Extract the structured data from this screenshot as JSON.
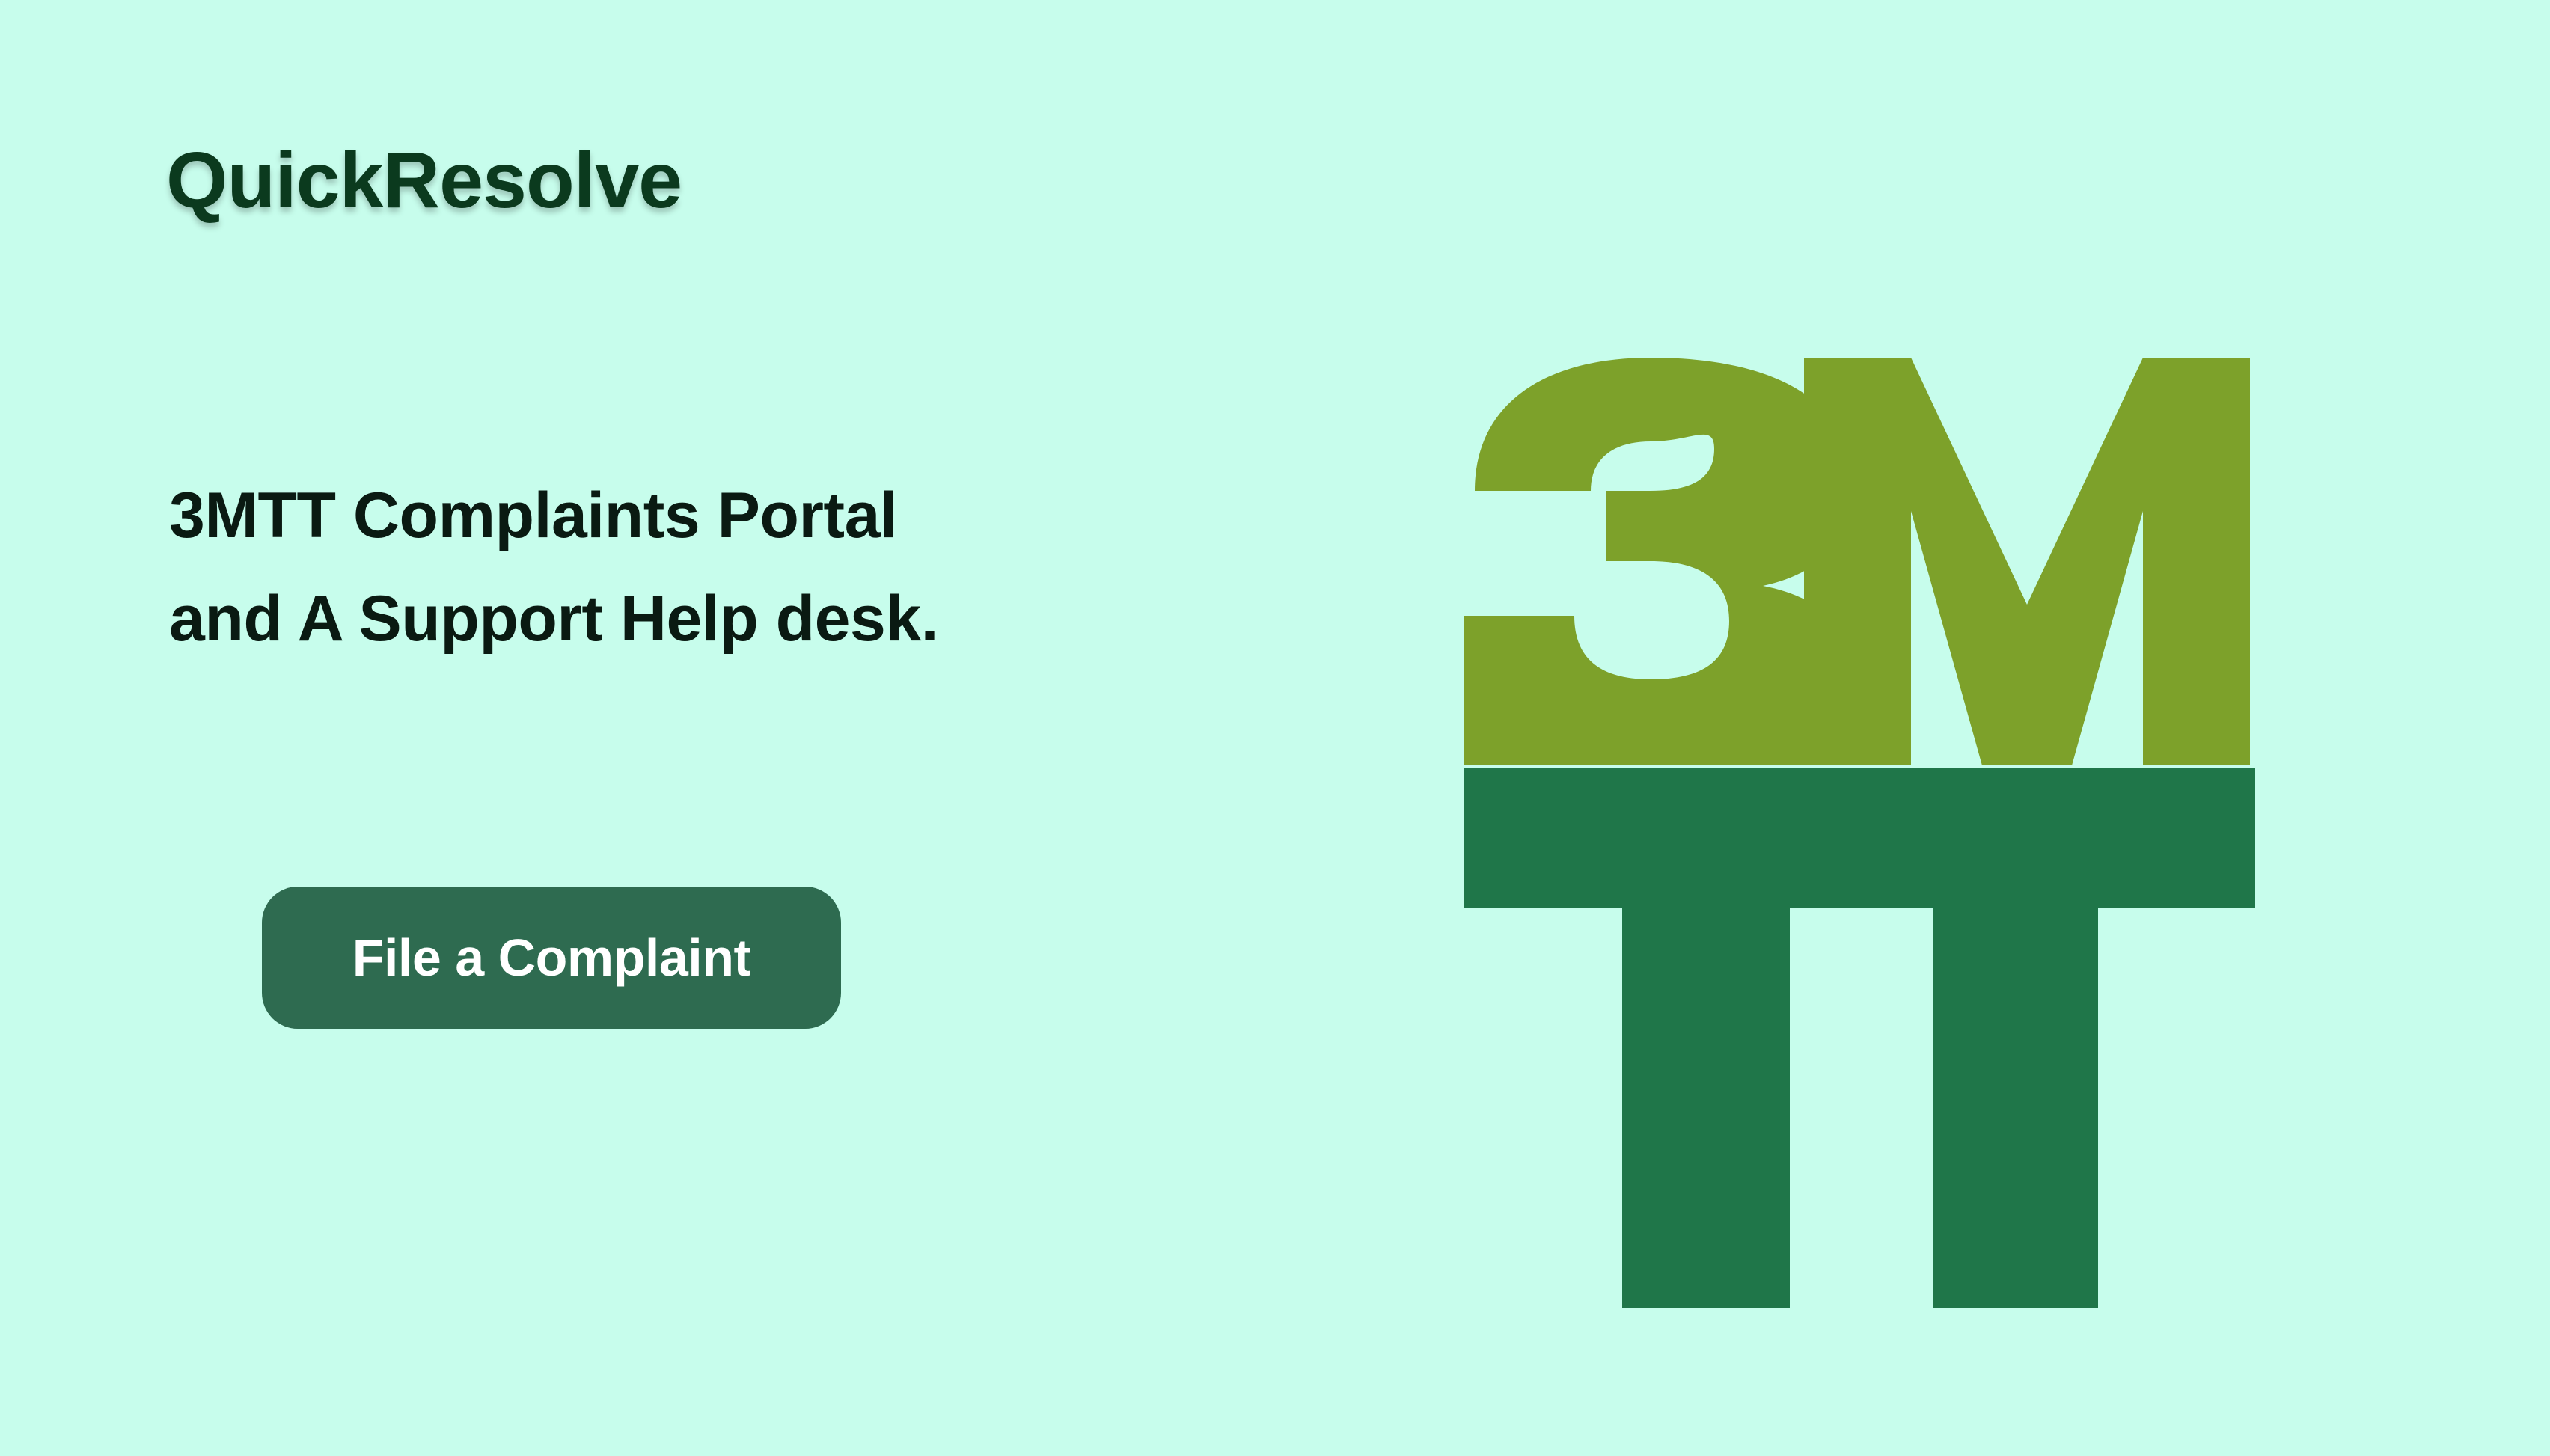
{
  "brand": {
    "name": "QuickResolve",
    "color": "#0b3a1e"
  },
  "hero": {
    "headline_line1": "3MTT Complaints Portal",
    "headline_line2": "and A Support Help desk.",
    "cta_label": "File a Complaint"
  },
  "logo": {
    "name": "3mtt-logo",
    "text_top": "3M",
    "text_bottom": "TT",
    "color_top": "#7da12a",
    "color_bottom": "#1f7649"
  },
  "theme": {
    "background": "#c7fdec",
    "button": "#2e6b50"
  }
}
